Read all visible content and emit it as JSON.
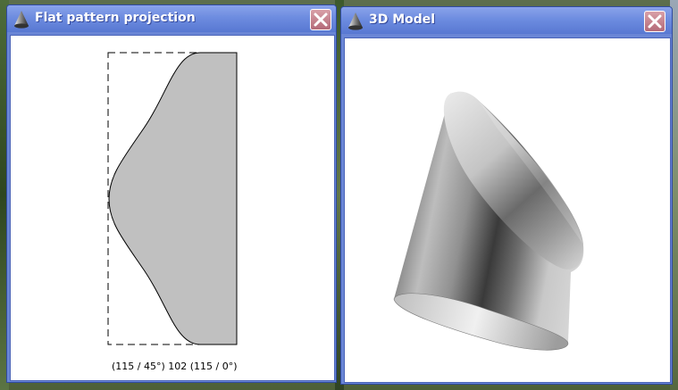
{
  "windows": {
    "flat": {
      "title": "Flat pattern projection",
      "icon": "cone-icon",
      "close_icon": "close-icon",
      "coordinate_label": "(115 / 45°) 102 (115 / 0°)"
    },
    "model": {
      "title": "3D Model",
      "icon": "cone-icon",
      "close_icon": "close-icon"
    }
  },
  "colors": {
    "titlebar": "#6d8ce0",
    "close_button": "#c07c88",
    "pattern_fill": "#c0c0c0",
    "client_background": "#ffffff"
  }
}
